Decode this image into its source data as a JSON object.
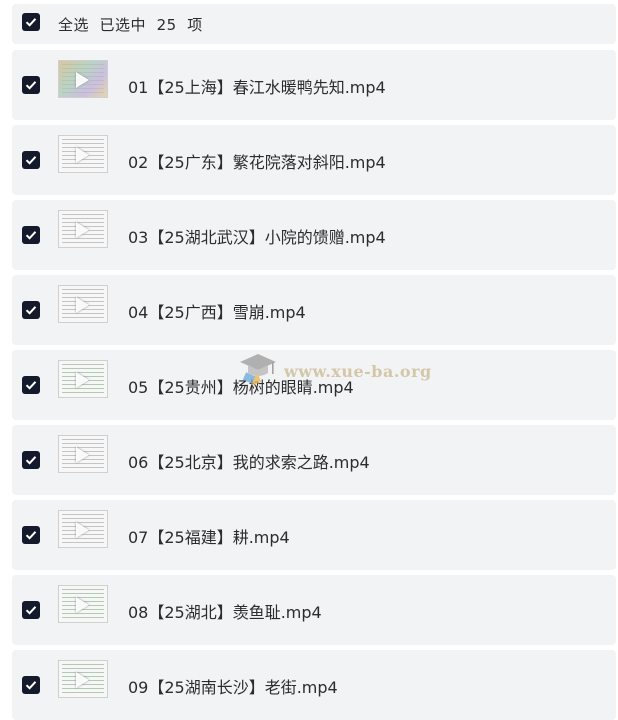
{
  "header": {
    "select_all_label": "全选  已选中  25  项",
    "checked": true
  },
  "items": [
    {
      "title": "01【25上海】春江水暖鸭先知.mp4",
      "checked": true,
      "thumb_style": "colorful"
    },
    {
      "title": "02【25广东】繁花院落对斜阳.mp4",
      "checked": true,
      "thumb_style": "text"
    },
    {
      "title": "03【25湖北武汉】小院的馈赠.mp4",
      "checked": true,
      "thumb_style": "text"
    },
    {
      "title": "04【25广西】雪崩.mp4",
      "checked": true,
      "thumb_style": "text"
    },
    {
      "title": "05【25贵州】杨树的眼睛.mp4",
      "checked": true,
      "thumb_style": "accent"
    },
    {
      "title": "06【25北京】我的求索之路.mp4",
      "checked": true,
      "thumb_style": "text"
    },
    {
      "title": "07【25福建】耕.mp4",
      "checked": true,
      "thumb_style": "text"
    },
    {
      "title": "08【25湖北】羡鱼耻.mp4",
      "checked": true,
      "thumb_style": "accent"
    },
    {
      "title": "09【25湖南长沙】老街.mp4",
      "checked": true,
      "thumb_style": "accent"
    }
  ],
  "watermark": {
    "text": "www.xue-ba.org"
  },
  "colors": {
    "checkbox": "#141a2b",
    "row_bg": "#f2f3f5",
    "text": "#2c2c2c"
  }
}
